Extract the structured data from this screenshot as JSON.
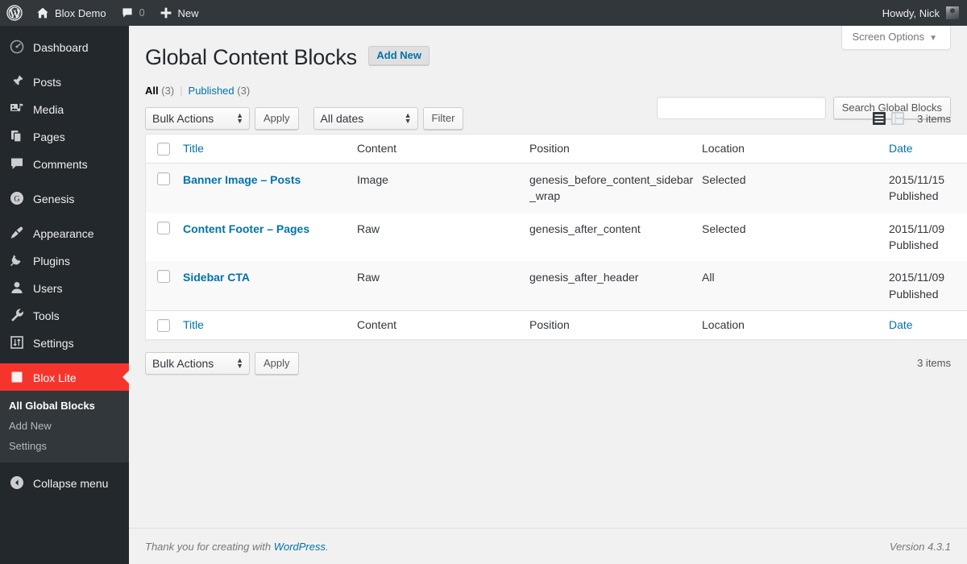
{
  "adminbar": {
    "logo_icon": "wordpress-logo-icon",
    "site_name": "Blox Demo",
    "site_icon": "home-icon",
    "comments_icon": "comment-bubble-icon",
    "comments_count": "0",
    "new_icon": "plus-icon",
    "new_label": "New",
    "howdy": "Howdy, Nick",
    "avatar_icon": "user-avatar"
  },
  "sidebar": {
    "items": [
      {
        "label": "Dashboard",
        "icon": "dashboard-gauge-icon",
        "current": false
      },
      {
        "label": "Posts",
        "icon": "pin-icon",
        "current": false
      },
      {
        "label": "Media",
        "icon": "media-icon",
        "current": false
      },
      {
        "label": "Pages",
        "icon": "pages-icon",
        "current": false
      },
      {
        "label": "Comments",
        "icon": "comment-bubble-icon",
        "current": false
      },
      {
        "label": "Genesis",
        "icon": "genesis-g-icon",
        "current": false
      },
      {
        "label": "Appearance",
        "icon": "paintbrush-icon",
        "current": false
      },
      {
        "label": "Plugins",
        "icon": "plugin-plug-icon",
        "current": false
      },
      {
        "label": "Users",
        "icon": "user-icon",
        "current": false
      },
      {
        "label": "Tools",
        "icon": "wrench-icon",
        "current": false
      },
      {
        "label": "Settings",
        "icon": "settings-sliders-icon",
        "current": false
      },
      {
        "label": "Blox Lite",
        "icon": "blox-square-icon",
        "current": true
      }
    ],
    "submenu": [
      {
        "label": "All Global Blocks",
        "current": true
      },
      {
        "label": "Add New",
        "current": false
      },
      {
        "label": "Settings",
        "current": false
      }
    ],
    "collapse": {
      "label": "Collapse menu",
      "icon": "collapse-arrow-icon"
    },
    "highlight_color": "#f5352b"
  },
  "screen_meta": {
    "screen_options_label": "Screen Options",
    "caret_icon": "chevron-down-icon"
  },
  "page": {
    "title": "Global Content Blocks",
    "add_new_label": "Add New"
  },
  "views": {
    "all_label": "All",
    "all_count": "(3)",
    "divider": "|",
    "published_label": "Published",
    "published_count": "(3)"
  },
  "search": {
    "value": "",
    "placeholder": "",
    "button_label": "Search Global Blocks"
  },
  "tablenav_top": {
    "bulk_actions_value": "Bulk Actions",
    "apply_label": "Apply",
    "dates_value": "All dates",
    "filter_label": "Filter",
    "list_view_icon": "list-view-icon",
    "excerpt_view_icon": "excerpt-view-icon",
    "items_count": "3 items"
  },
  "tablenav_bottom": {
    "bulk_actions_value": "Bulk Actions",
    "apply_label": "Apply",
    "items_count": "3 items"
  },
  "table": {
    "columns": [
      {
        "label": "Title",
        "sortable": true
      },
      {
        "label": "Content",
        "sortable": false
      },
      {
        "label": "Position",
        "sortable": false
      },
      {
        "label": "Location",
        "sortable": false
      },
      {
        "label": "Date",
        "sortable": true
      }
    ],
    "rows": [
      {
        "title": "Banner Image – Posts",
        "content": "Image",
        "position": "genesis_before_content_sidebar_wrap",
        "location": "Selected",
        "date": "2015/11/15",
        "status": "Published"
      },
      {
        "title": "Content Footer – Pages",
        "content": "Raw",
        "position": "genesis_after_content",
        "location": "Selected",
        "date": "2015/11/09",
        "status": "Published"
      },
      {
        "title": "Sidebar CTA",
        "content": "Raw",
        "position": "genesis_after_header",
        "location": "All",
        "date": "2015/11/09",
        "status": "Published"
      }
    ]
  },
  "footer": {
    "thanks_prefix": "Thank you for creating with ",
    "wordpress_link": "WordPress",
    "thanks_suffix": ".",
    "version": "Version 4.3.1"
  }
}
